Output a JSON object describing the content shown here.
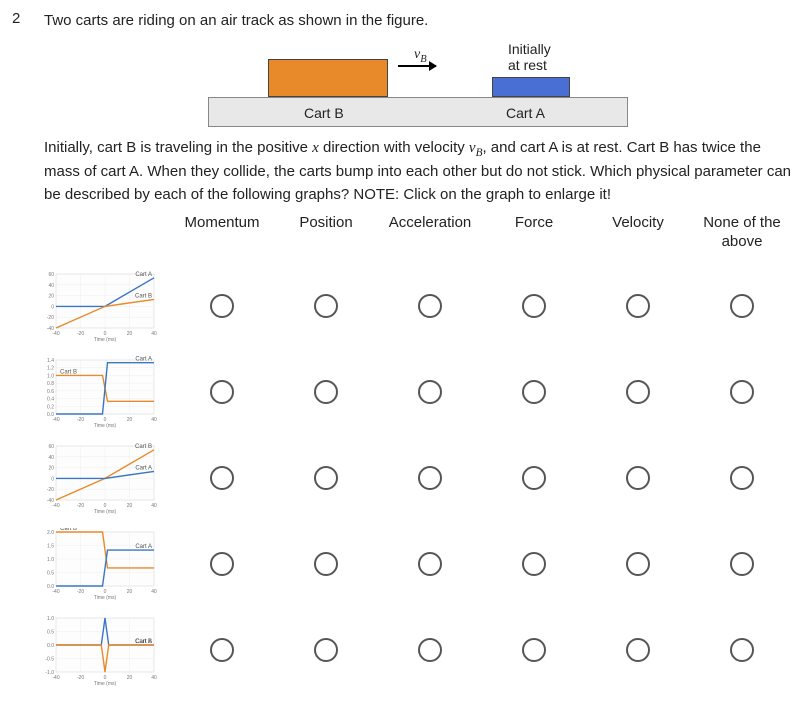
{
  "question_number": "2",
  "intro_text": "Two carts are riding on an air track as shown in the figure.",
  "diagram": {
    "vb_label": "v",
    "vb_sub": "B",
    "at_rest_line1": "Initially",
    "at_rest_line2": "at rest",
    "cartB_label": "Cart B",
    "cartA_label": "Cart A"
  },
  "body_text_1": "Initially, cart B is traveling in the positive ",
  "body_text_x": "x",
  "body_text_2": " direction with velocity ",
  "body_text_vb": "v",
  "body_text_vb_sub": "B",
  "body_text_3": ", and cart A is at rest. Cart B has twice the mass of cart A. When they collide, the carts bump into each other but do not stick. Which physical parameter can be described by each of the following graphs? NOTE: Click on the graph to enlarge it!",
  "columns": [
    "Momentum",
    "Position",
    "Acceleration",
    "Force",
    "Velocity",
    "None of the above"
  ],
  "rows": [
    {
      "labelA": "Cart A",
      "labelB": "Cart B",
      "yTicks": [
        "60",
        "40",
        "20",
        "0",
        "-20",
        "-40"
      ],
      "xTicks": [
        "-40",
        "-20",
        "0",
        "20",
        "40"
      ],
      "xAxis": "Time (ms)",
      "style": "position-lines-A-top"
    },
    {
      "labelA": "Cart A",
      "labelB": "Cart B",
      "yTicks": [
        "1.4",
        "1.2",
        "1.0",
        "0.8",
        "0.6",
        "0.4",
        "0.2",
        "0.0"
      ],
      "xTicks": [
        "-40",
        "-20",
        "0",
        "20",
        "40"
      ],
      "xAxis": "Time (ms)",
      "style": "step-B-top"
    },
    {
      "labelA": "Cart A",
      "labelB": "Cart B",
      "yTicks": [
        "60",
        "40",
        "20",
        "0",
        "-20",
        "-40"
      ],
      "xTicks": [
        "-40",
        "-20",
        "0",
        "20",
        "40"
      ],
      "xAxis": "Time (ms)",
      "style": "position-lines-B-top"
    },
    {
      "labelA": "Cart A",
      "labelB": "Cart B",
      "yTicks": [
        "2.0",
        "1.5",
        "1.0",
        "0.5",
        "0.0"
      ],
      "xTicks": [
        "-40",
        "-20",
        "0",
        "20",
        "40"
      ],
      "xAxis": "Time (ms)",
      "style": "step-B-top-2"
    },
    {
      "labelA": "Cart A",
      "labelB": "Cart B",
      "yTicks": [
        "1.0",
        "0.5",
        "0.0",
        "-0.5",
        "-1.0"
      ],
      "xTicks": [
        "-40",
        "-20",
        "0",
        "20",
        "40"
      ],
      "xAxis": "Time (ms)",
      "style": "impulse"
    }
  ],
  "chart_data": [
    {
      "type": "line",
      "title": "",
      "xlabel": "Time (ms)",
      "ylabel": "",
      "xlim": [
        -40,
        40
      ],
      "ylim": [
        -40,
        60
      ],
      "series": [
        {
          "name": "Cart A",
          "points": [
            [
              -40,
              0
            ],
            [
              0,
              0
            ],
            [
              40,
              53
            ]
          ]
        },
        {
          "name": "Cart B",
          "points": [
            [
              -40,
              -40
            ],
            [
              0,
              0
            ],
            [
              40,
              13
            ]
          ]
        }
      ]
    },
    {
      "type": "line",
      "title": "",
      "xlabel": "Time (ms)",
      "ylabel": "",
      "xlim": [
        -40,
        40
      ],
      "ylim": [
        0,
        1.4
      ],
      "series": [
        {
          "name": "Cart B",
          "points": [
            [
              -40,
              1.0
            ],
            [
              -2,
              1.0
            ],
            [
              2,
              0.33
            ],
            [
              40,
              0.33
            ]
          ]
        },
        {
          "name": "Cart A",
          "points": [
            [
              -40,
              0.0
            ],
            [
              -2,
              0.0
            ],
            [
              2,
              1.33
            ],
            [
              40,
              1.33
            ]
          ]
        }
      ]
    },
    {
      "type": "line",
      "title": "",
      "xlabel": "Time (ms)",
      "ylabel": "",
      "xlim": [
        -40,
        40
      ],
      "ylim": [
        -40,
        60
      ],
      "series": [
        {
          "name": "Cart B",
          "points": [
            [
              -40,
              -40
            ],
            [
              0,
              0
            ],
            [
              40,
              53
            ]
          ]
        },
        {
          "name": "Cart A",
          "points": [
            [
              -40,
              0
            ],
            [
              0,
              0
            ],
            [
              40,
              13
            ]
          ]
        }
      ]
    },
    {
      "type": "line",
      "title": "",
      "xlabel": "Time (ms)",
      "ylabel": "",
      "xlim": [
        -40,
        40
      ],
      "ylim": [
        0,
        2.0
      ],
      "series": [
        {
          "name": "Cart B",
          "points": [
            [
              -40,
              2.0
            ],
            [
              -2,
              2.0
            ],
            [
              2,
              0.67
            ],
            [
              40,
              0.67
            ]
          ]
        },
        {
          "name": "Cart A",
          "points": [
            [
              -40,
              0.0
            ],
            [
              -2,
              0.0
            ],
            [
              2,
              1.33
            ],
            [
              40,
              1.33
            ]
          ]
        }
      ]
    },
    {
      "type": "line",
      "title": "",
      "xlabel": "Time (ms)",
      "ylabel": "",
      "xlim": [
        -40,
        40
      ],
      "ylim": [
        -1.0,
        1.0
      ],
      "series": [
        {
          "name": "Cart A",
          "points": [
            [
              -40,
              0
            ],
            [
              -3,
              0
            ],
            [
              0,
              1.0
            ],
            [
              3,
              0
            ],
            [
              40,
              0
            ]
          ]
        },
        {
          "name": "Cart B",
          "points": [
            [
              -40,
              0
            ],
            [
              -3,
              0
            ],
            [
              0,
              -1.0
            ],
            [
              3,
              0
            ],
            [
              40,
              0
            ]
          ]
        }
      ]
    }
  ]
}
